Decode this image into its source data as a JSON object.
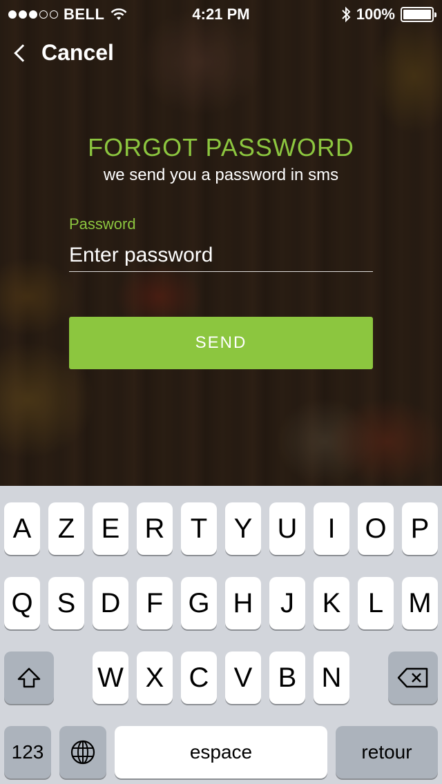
{
  "status_bar": {
    "signal_dots": [
      true,
      true,
      true,
      false,
      false
    ],
    "carrier": "BELL",
    "time": "4:21 PM",
    "battery": "100%",
    "wifi_icon": "wifi-icon",
    "bluetooth_icon": "bluetooth-icon"
  },
  "nav": {
    "cancel_label": "Cancel"
  },
  "form": {
    "title": "FORGOT PASSWORD",
    "subtitle": "we send you a password in sms",
    "password_label": "Password",
    "password_placeholder": "Enter password",
    "send_label": "SEND"
  },
  "colors": {
    "accent": "#8cc63f",
    "keyboard_bg": "#d2d5db",
    "dark_key": "#acb3bc"
  },
  "keyboard": {
    "row1": [
      "A",
      "Z",
      "E",
      "R",
      "T",
      "Y",
      "U",
      "I",
      "O",
      "P"
    ],
    "row2": [
      "Q",
      "S",
      "D",
      "F",
      "G",
      "H",
      "J",
      "K",
      "L",
      "M"
    ],
    "row3": [
      "W",
      "X",
      "C",
      "V",
      "B",
      "N"
    ],
    "numbers_label": "123",
    "space_label": "espace",
    "return_label": "retour"
  }
}
